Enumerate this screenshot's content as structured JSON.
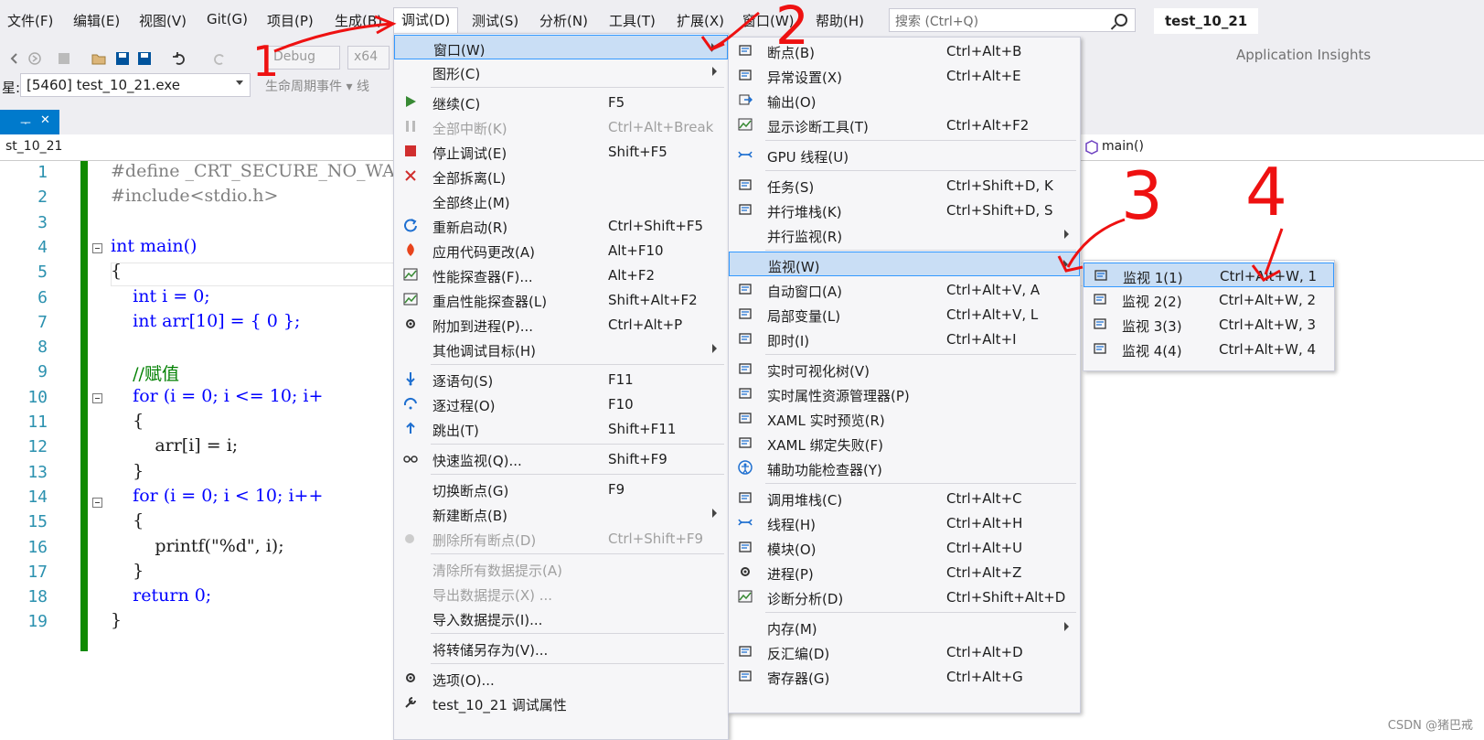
{
  "menubar": {
    "items": [
      "文件(F)",
      "编辑(E)",
      "视图(V)",
      "Git(G)",
      "项目(P)",
      "生成(B)",
      "调试(D)",
      "测试(S)",
      "分析(N)",
      "工具(T)",
      "扩展(X)",
      "窗口(W)",
      "帮助(H)"
    ],
    "search_placeholder": "搜索 (Ctrl+Q)",
    "solution_name": "test_10_21"
  },
  "toolbar": {
    "config": "Debug",
    "platform": "x64",
    "app_insights": "Application Insights"
  },
  "process": {
    "label_fragment": "星:",
    "selected": "[5460] test_10_21.exe",
    "lifecycle": "生命周期事件",
    "lifecycle_tail": "线"
  },
  "tab": {
    "pin_glyph": "ᅮ",
    "close_glyph": "✕"
  },
  "navbar": {
    "file": "st_10_21",
    "function": "main()"
  },
  "editor": {
    "lines": [
      {
        "n": "1",
        "text": "#define _CRT_SECURE_NO_WARN"
      },
      {
        "n": "2",
        "text": "#include<stdio.h>"
      },
      {
        "n": "3",
        "text": ""
      },
      {
        "n": "4",
        "text": "int main()"
      },
      {
        "n": "5",
        "text": "{"
      },
      {
        "n": "6",
        "text": "    int i = 0;"
      },
      {
        "n": "7",
        "text": "    int arr[10] = { 0 };"
      },
      {
        "n": "8",
        "text": ""
      },
      {
        "n": "9",
        "text": "    //赋值"
      },
      {
        "n": "10",
        "text": "    for (i = 0; i <= 10; i+"
      },
      {
        "n": "11",
        "text": "    {"
      },
      {
        "n": "12",
        "text": "        arr[i] = i;"
      },
      {
        "n": "13",
        "text": "    }"
      },
      {
        "n": "14",
        "text": "    for (i = 0; i < 10; i++"
      },
      {
        "n": "15",
        "text": "    {"
      },
      {
        "n": "16",
        "text": "        printf(\"%d\", i);"
      },
      {
        "n": "17",
        "text": "    }"
      },
      {
        "n": "18",
        "text": "    return 0;"
      },
      {
        "n": "19",
        "text": "}"
      }
    ]
  },
  "debug_menu": [
    {
      "label": "窗口(W)",
      "shortcut": "",
      "sub": true,
      "hl": true
    },
    {
      "label": "图形(C)",
      "shortcut": "",
      "sub": true
    },
    {
      "label": "继续(C)",
      "shortcut": "F5",
      "icon": "play-icon"
    },
    {
      "label": "全部中断(K)",
      "shortcut": "Ctrl+Alt+Break",
      "dis": true,
      "icon": "pause-icon"
    },
    {
      "label": "停止调试(E)",
      "shortcut": "Shift+F5",
      "icon": "stop-icon"
    },
    {
      "label": "全部拆离(L)",
      "shortcut": "",
      "icon": "detach-icon"
    },
    {
      "label": "全部终止(M)",
      "shortcut": ""
    },
    {
      "label": "重新启动(R)",
      "shortcut": "Ctrl+Shift+F5",
      "icon": "restart-icon"
    },
    {
      "label": "应用代码更改(A)",
      "shortcut": "Alt+F10",
      "icon": "hot-reload-icon"
    },
    {
      "label": "性能探查器(F)...",
      "shortcut": "Alt+F2",
      "icon": "profiler-icon"
    },
    {
      "label": "重启性能探查器(L)",
      "shortcut": "Shift+Alt+F2",
      "icon": "profiler-restart-icon"
    },
    {
      "label": "附加到进程(P)...",
      "shortcut": "Ctrl+Alt+P",
      "icon": "attach-icon"
    },
    {
      "label": "其他调试目标(H)",
      "shortcut": "",
      "sub": true
    },
    {
      "label": "逐语句(S)",
      "shortcut": "F11",
      "icon": "step-into-icon"
    },
    {
      "label": "逐过程(O)",
      "shortcut": "F10",
      "icon": "step-over-icon"
    },
    {
      "label": "跳出(T)",
      "shortcut": "Shift+F11",
      "icon": "step-out-icon"
    },
    {
      "label": "快速监视(Q)...",
      "shortcut": "Shift+F9",
      "icon": "glasses-icon"
    },
    {
      "label": "切换断点(G)",
      "shortcut": "F9"
    },
    {
      "label": "新建断点(B)",
      "shortcut": "",
      "sub": true
    },
    {
      "label": "删除所有断点(D)",
      "shortcut": "Ctrl+Shift+F9",
      "dis": true,
      "icon": "delete-breakpoints-icon"
    },
    {
      "label": "清除所有数据提示(A)",
      "shortcut": "",
      "dis": true
    },
    {
      "label": "导出数据提示(X) ...",
      "shortcut": "",
      "dis": true
    },
    {
      "label": "导入数据提示(I)...",
      "shortcut": ""
    },
    {
      "label": "将转储另存为(V)...",
      "shortcut": ""
    },
    {
      "label": "选项(O)...",
      "shortcut": "",
      "icon": "gear-icon"
    },
    {
      "label": "test_10_21 调试属性",
      "shortcut": "",
      "icon": "wrench-icon"
    }
  ],
  "window_menu": [
    {
      "label": "断点(B)",
      "shortcut": "Ctrl+Alt+B",
      "icon": "breakpoints-icon"
    },
    {
      "label": "异常设置(X)",
      "shortcut": "Ctrl+Alt+E",
      "icon": "exception-icon"
    },
    {
      "label": "输出(O)",
      "shortcut": "",
      "icon": "output-icon"
    },
    {
      "label": "显示诊断工具(T)",
      "shortcut": "Ctrl+Alt+F2",
      "icon": "diagnostics-icon"
    },
    {
      "label": "GPU 线程(U)",
      "shortcut": "",
      "icon": "gpu-threads-icon"
    },
    {
      "label": "任务(S)",
      "shortcut": "Ctrl+Shift+D, K",
      "icon": "tasks-icon"
    },
    {
      "label": "并行堆栈(K)",
      "shortcut": "Ctrl+Shift+D, S",
      "icon": "parallel-stacks-icon"
    },
    {
      "label": "并行监视(R)",
      "shortcut": "",
      "sub": true
    },
    {
      "label": "监视(W)",
      "shortcut": "",
      "sub": true,
      "hl": true
    },
    {
      "label": "自动窗口(A)",
      "shortcut": "Ctrl+Alt+V, A",
      "icon": "autos-icon"
    },
    {
      "label": "局部变量(L)",
      "shortcut": "Ctrl+Alt+V, L",
      "icon": "locals-icon"
    },
    {
      "label": "即时(I)",
      "shortcut": "Ctrl+Alt+I",
      "icon": "immediate-icon"
    },
    {
      "label": "实时可视化树(V)",
      "shortcut": "",
      "icon": "visual-tree-icon"
    },
    {
      "label": "实时属性资源管理器(P)",
      "shortcut": "",
      "icon": "property-explorer-icon"
    },
    {
      "label": "XAML 实时预览(R)",
      "shortcut": "",
      "icon": "xaml-preview-icon"
    },
    {
      "label": "XAML 绑定失败(F)",
      "shortcut": "",
      "icon": "xaml-binding-icon"
    },
    {
      "label": "辅助功能检查器(Y)",
      "shortcut": "",
      "icon": "accessibility-icon"
    },
    {
      "label": "调用堆栈(C)",
      "shortcut": "Ctrl+Alt+C",
      "icon": "call-stack-icon"
    },
    {
      "label": "线程(H)",
      "shortcut": "Ctrl+Alt+H",
      "icon": "threads-icon"
    },
    {
      "label": "模块(O)",
      "shortcut": "Ctrl+Alt+U",
      "icon": "modules-icon"
    },
    {
      "label": "进程(P)",
      "shortcut": "Ctrl+Alt+Z",
      "icon": "processes-icon"
    },
    {
      "label": "诊断分析(D)",
      "shortcut": "Ctrl+Shift+Alt+D",
      "icon": "diagnostic-analysis-icon"
    },
    {
      "label": "内存(M)",
      "shortcut": "",
      "sub": true
    },
    {
      "label": "反汇编(D)",
      "shortcut": "Ctrl+Alt+D",
      "icon": "disassembly-icon"
    },
    {
      "label": "寄存器(G)",
      "shortcut": "Ctrl+Alt+G",
      "icon": "registers-icon"
    }
  ],
  "watch_menu": [
    {
      "label": "监视 1(1)",
      "shortcut": "Ctrl+Alt+W, 1",
      "hl": true
    },
    {
      "label": "监视 2(2)",
      "shortcut": "Ctrl+Alt+W, 2"
    },
    {
      "label": "监视 3(3)",
      "shortcut": "Ctrl+Alt+W, 3"
    },
    {
      "label": "监视 4(4)",
      "shortcut": "Ctrl+Alt+W, 4"
    }
  ],
  "annotations": [
    "1",
    "2",
    "3",
    "4"
  ],
  "watermark": "CSDN @猪巴戒",
  "colors": {
    "accent": "#007acc",
    "highlight": "#c9def5",
    "annotation_red": "#ee1111",
    "keyword_blue": "#0000ff",
    "comment_green": "#008000"
  }
}
